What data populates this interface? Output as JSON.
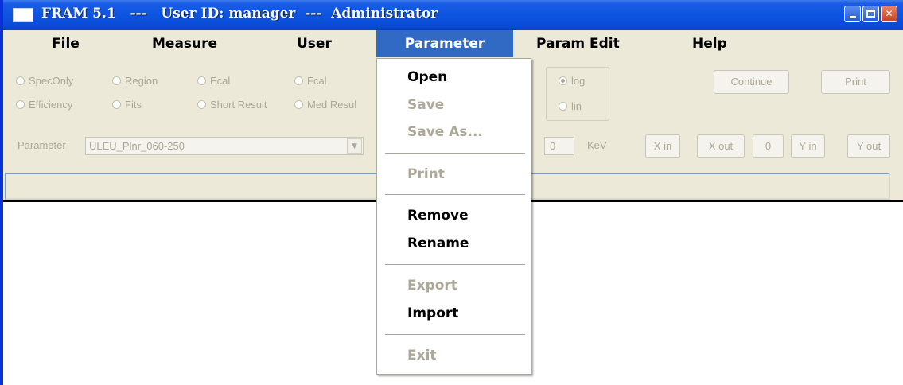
{
  "window": {
    "title": "FRAM 5.1   ---   User ID: manager  ---  Administrator",
    "min_glyph": "_",
    "close_glyph": "✕"
  },
  "menubar": {
    "items": [
      {
        "label": "File"
      },
      {
        "label": "Measure"
      },
      {
        "label": "User"
      },
      {
        "label": "Parameter"
      },
      {
        "label": "Param Edit"
      },
      {
        "label": "Help"
      }
    ]
  },
  "view_modes": {
    "row1": [
      "SpecOnly",
      "Region",
      "Ecal",
      "Fcal"
    ],
    "row2": [
      "Efficiency",
      "Fits",
      "Short Result",
      "Med Resul"
    ]
  },
  "scale": {
    "options": [
      "log",
      "lin"
    ],
    "selected": "log"
  },
  "buttons": {
    "continue": "Continue",
    "print": "Print",
    "x_in": "X in",
    "x_out": "X out",
    "zero": "0",
    "y_in": "Y in",
    "y_out": "Y out"
  },
  "parameter": {
    "label": "Parameter",
    "selected": "ULEU_Plnr_060-250"
  },
  "energy": {
    "value": "0",
    "unit": "KeV"
  },
  "parameter_menu": {
    "items": [
      {
        "label": "Open",
        "enabled": true
      },
      {
        "label": "Save",
        "enabled": false
      },
      {
        "label": "Save As...",
        "enabled": false
      },
      {
        "label": "Print",
        "enabled": false
      },
      {
        "label": "Remove",
        "enabled": true
      },
      {
        "label": "Rename",
        "enabled": true
      },
      {
        "label": "Export",
        "enabled": false
      },
      {
        "label": "Import",
        "enabled": true
      },
      {
        "label": "Exit",
        "enabled": false
      }
    ]
  },
  "colors": {
    "titlebar": "#0c54e0",
    "menu_highlight": "#316ac5",
    "face": "#ece9d8",
    "disabled_text": "#aca899"
  }
}
